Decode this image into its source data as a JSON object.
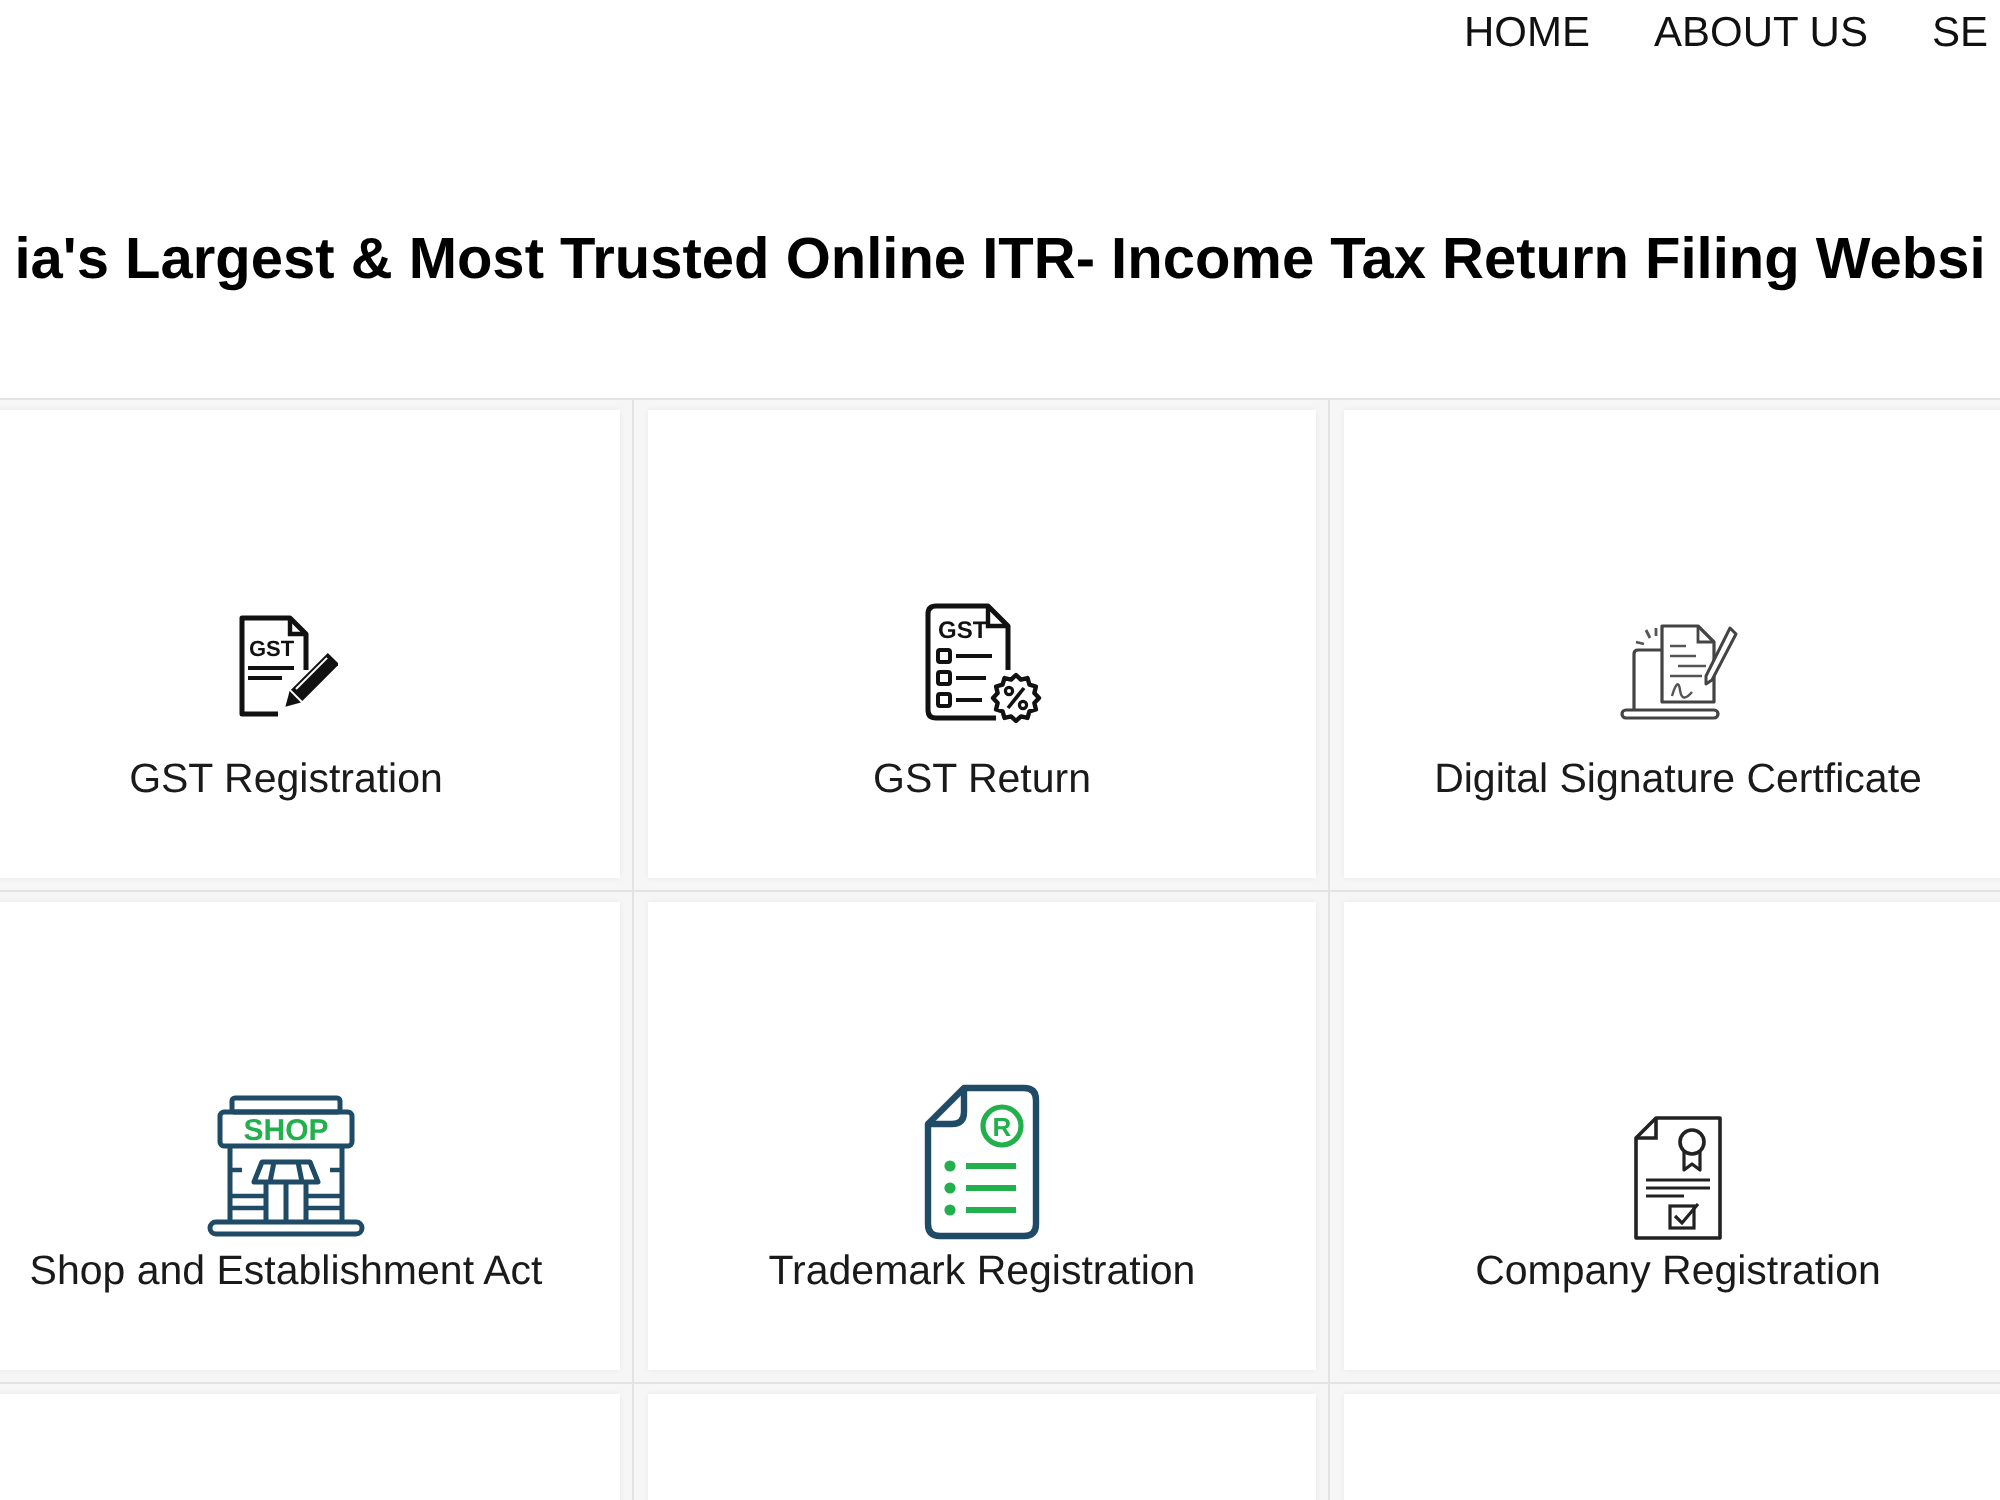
{
  "nav": [
    "HOME",
    "ABOUT US",
    "SE"
  ],
  "heading": "ia's Largest & Most Trusted Online ITR- Income Tax Return Filing Websi",
  "services": [
    {
      "kind": "pencil",
      "icon_text": "GST",
      "title": "GST Registration"
    },
    {
      "kind": "checklist",
      "icon_text": "GST",
      "title": "GST Return"
    },
    {
      "kind": "laptop",
      "title": "Digital Signature Certficate"
    },
    {
      "kind": "shop",
      "icon_text": "SHOP",
      "title": "Shop and Establishment Act"
    },
    {
      "kind": "trademark",
      "icon_text": "R",
      "title": "Trademark Registration"
    },
    {
      "kind": "certificate",
      "title": "Company Registration"
    }
  ]
}
